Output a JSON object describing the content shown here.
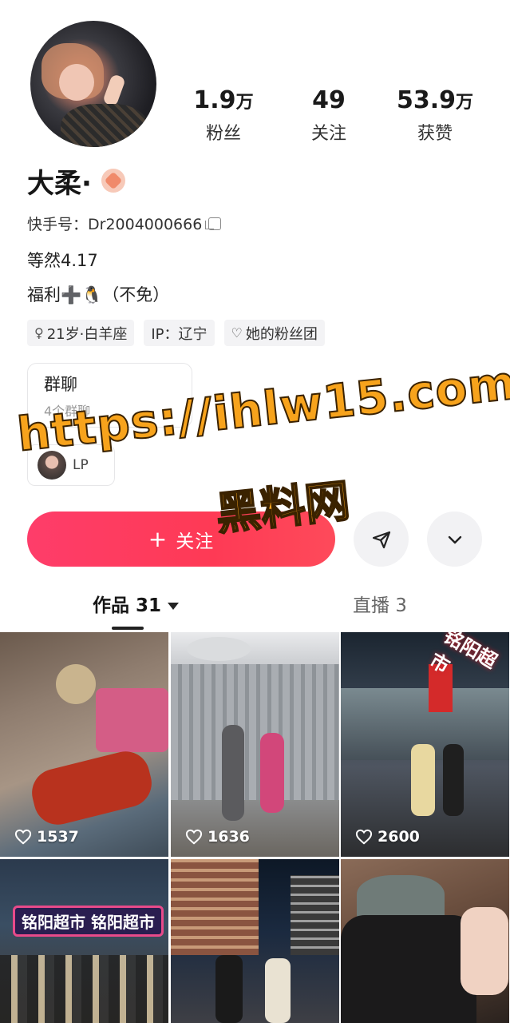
{
  "profile": {
    "name": "大柔·",
    "kuaishou_id": "快手号：Dr2004000666",
    "bio_line1": "等然4.17",
    "bio_line2": "福利➕🐧（不免）"
  },
  "stats": [
    {
      "value": "1.9",
      "unit": "万",
      "label": "粉丝"
    },
    {
      "value": "49",
      "unit": "",
      "label": "关注"
    },
    {
      "value": "53.9",
      "unit": "万",
      "label": "获赞"
    }
  ],
  "tags": [
    {
      "icon": "♀",
      "text": "21岁·白羊座"
    },
    {
      "icon": "",
      "text": "IP：辽宁"
    },
    {
      "icon": "♡",
      "text": "她的粉丝团"
    }
  ],
  "group_chat": {
    "title": "群聊",
    "subtitle": "4个群聊"
  },
  "mini_card_text": "LP",
  "actions": {
    "follow_label": "关注",
    "follow_plus": "+"
  },
  "watermark": {
    "line1": "https://ihlw15.com",
    "line2": "黑料网"
  },
  "tabs": [
    {
      "label": "作品 31",
      "active": true
    },
    {
      "label": "直播 3",
      "active": false
    }
  ],
  "videos": [
    {
      "likes": "1537"
    },
    {
      "likes": "1636"
    },
    {
      "likes": "2600"
    },
    {
      "likes": ""
    },
    {
      "likes": ""
    },
    {
      "likes": ""
    }
  ],
  "video_texts": {
    "c3_sign": "铭阳超市",
    "c4_sign": "铭阳超市 铭阳超市"
  },
  "colors": {
    "follow_button": "#fe3d6a",
    "watermark": "#f7a31c"
  },
  "icons": {
    "copy": "copy-icon",
    "share": "send-icon",
    "more": "chevron-down-icon",
    "heart": "heart-icon"
  }
}
